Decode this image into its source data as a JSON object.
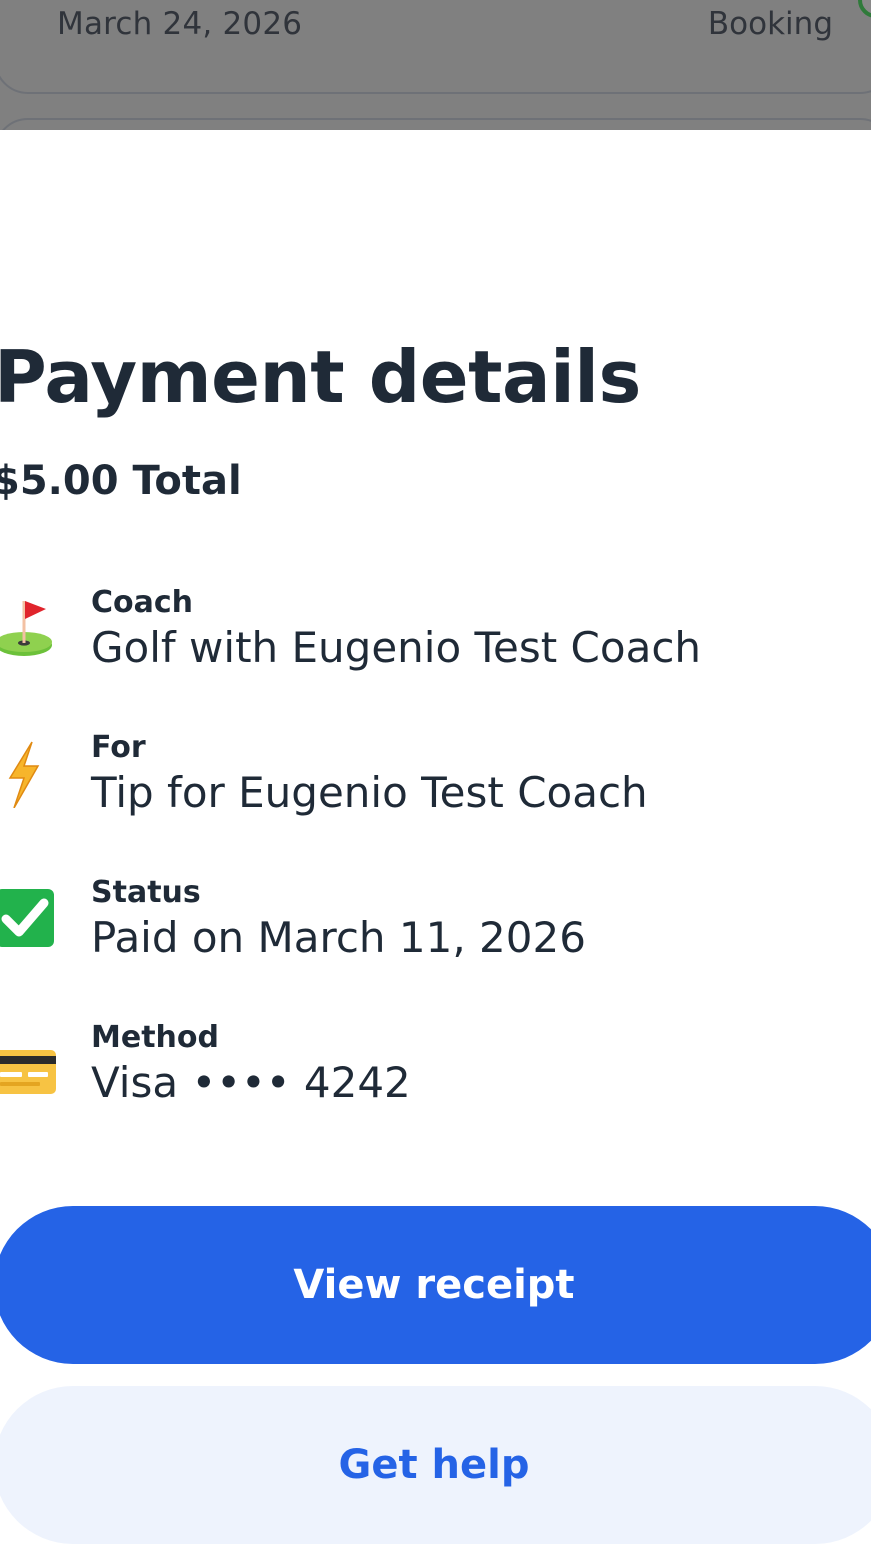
{
  "background_item": {
    "date": "March 24, 2026",
    "type": "Booking"
  },
  "sheet": {
    "title": "Payment details",
    "total": "$5.00 Total",
    "rows": [
      {
        "icon": "golf-flag-icon",
        "label": "Coach",
        "value": "Golf with Eugenio Test Coach"
      },
      {
        "icon": "lightning-icon",
        "label": "For",
        "value": "Tip for Eugenio Test Coach"
      },
      {
        "icon": "check-mark-icon",
        "label": "Status",
        "value": "Paid on March 11, 2026"
      },
      {
        "icon": "credit-card-icon",
        "label": "Method",
        "value": "Visa •••• 4242"
      }
    ],
    "primary_button": "View receipt",
    "secondary_button": "Get help"
  },
  "colors": {
    "primary": "#2563e6",
    "secondary_bg": "#eef3fd",
    "text": "#1f2a37",
    "overlay": "#808080"
  }
}
